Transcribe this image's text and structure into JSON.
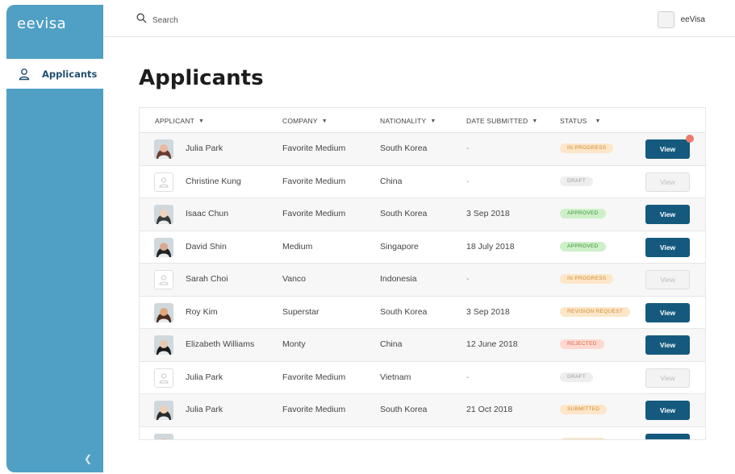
{
  "app": {
    "brand": "eevisa"
  },
  "sidebar": {
    "items": [
      {
        "label": "Applicants",
        "icon": "user-icon"
      }
    ],
    "collapse_icon": "chevron-left-icon"
  },
  "topbar": {
    "search_label": "Search",
    "account_name": "eeVisa"
  },
  "page": {
    "title": "Applicants"
  },
  "table": {
    "columns": [
      "APPLICANT",
      "COMPANY",
      "NATIONALITY",
      "DATE SUBMITTED",
      "STATUS"
    ],
    "view_label": "View",
    "rows": [
      {
        "name": "Julia Park",
        "company": "Favorite Medium",
        "nationality": "South Korea",
        "date": "-",
        "status": "IN PROGRESS",
        "status_kind": "inprogress",
        "photo": "photo",
        "view_enabled": true,
        "notification": true
      },
      {
        "name": "Christine Kung",
        "company": "Favorite Medium",
        "nationality": "China",
        "date": "-",
        "status": "DRAFT",
        "status_kind": "draft",
        "photo": "placeholder",
        "view_enabled": false
      },
      {
        "name": "Isaac Chun",
        "company": "Favorite Medium",
        "nationality": "South Korea",
        "date": "3 Sep 2018",
        "status": "APPROVED",
        "status_kind": "approved",
        "photo": "photo",
        "view_enabled": true
      },
      {
        "name": "David Shin",
        "company": "Medium",
        "nationality": "Singapore",
        "date": "18 July 2018",
        "status": "APPROVED",
        "status_kind": "approved",
        "photo": "photo",
        "view_enabled": true
      },
      {
        "name": "Sarah Choi",
        "company": "Vanco",
        "nationality": "Indonesia",
        "date": "-",
        "status": "IN PROGRESS",
        "status_kind": "inprogress",
        "photo": "placeholder",
        "view_enabled": false
      },
      {
        "name": "Roy Kim",
        "company": "Superstar",
        "nationality": "South Korea",
        "date": "3 Sep 2018",
        "status": "REVISION REQUEST",
        "status_kind": "revision",
        "photo": "photo",
        "view_enabled": true
      },
      {
        "name": "Elizabeth Williams",
        "company": "Monty",
        "nationality": "China",
        "date": "12 June 2018",
        "status": "REJECTED",
        "status_kind": "rejected",
        "photo": "photo",
        "view_enabled": true
      },
      {
        "name": "Julia Park",
        "company": "Favorite Medium",
        "nationality": "Vietnam",
        "date": "-",
        "status": "DRAFT",
        "status_kind": "draft",
        "photo": "placeholder",
        "view_enabled": false
      },
      {
        "name": "Julia Park",
        "company": "Favorite Medium",
        "nationality": "South Korea",
        "date": "21 Oct 2018",
        "status": "SUBMITTED",
        "status_kind": "submitted",
        "photo": "photo",
        "view_enabled": true
      },
      {
        "name": "",
        "company": "",
        "nationality": "",
        "date": "",
        "status": "",
        "status_kind": "inprogress",
        "photo": "photo",
        "view_enabled": true
      }
    ]
  },
  "colors": {
    "sidebar": "#4fa0c4",
    "primary_button": "#155a7e",
    "notification_dot": "#f17a6e"
  }
}
